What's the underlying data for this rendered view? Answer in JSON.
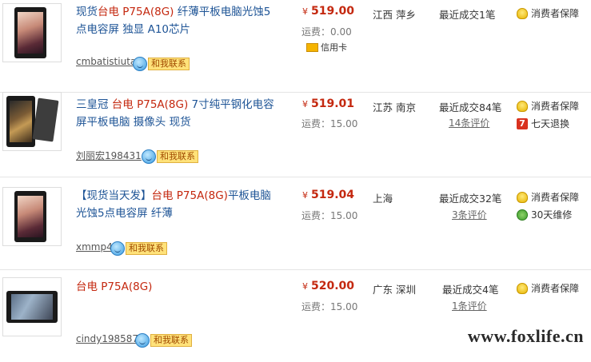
{
  "listings": [
    {
      "title_pre": "现货",
      "title_hl": "台电 P75A(8G)",
      "title_post": " 纤薄平板电脑光蚀5点电容屏 独显 A10芯片",
      "seller": "cmbatistiuta",
      "chat_label": "和我联系",
      "price": "519.00",
      "currency": "¥",
      "shipping": "运费：0.00",
      "payment": "信用卡",
      "location": "江西 萍乡",
      "deals": "最近成交1笔",
      "reviews": "",
      "services": [
        {
          "icon": "consumer-protection-icon",
          "label": "消费者保障"
        }
      ]
    },
    {
      "title_pre": "三皇冠 ",
      "title_hl": "台电 P75A(8G)",
      "title_post": " 7寸纯平钢化电容屏平板电脑 摄像头 现货",
      "seller": "刘丽宏198431",
      "chat_label": "和我联系",
      "price": "519.01",
      "currency": "¥",
      "shipping": "运费：15.00",
      "location": "江苏 南京",
      "deals": "最近成交84笔",
      "reviews": "14条评价",
      "services": [
        {
          "icon": "consumer-protection-icon",
          "label": "消费者保障"
        },
        {
          "icon": "seven-day-return-icon",
          "label": "七天退换"
        }
      ]
    },
    {
      "title_pre": "【现货当天发】",
      "title_hl": "台电 P75A(8G)",
      "title_post": "平板电脑 光蚀5点电容屏 纤薄",
      "seller": "xmmp4",
      "chat_label": "和我联系",
      "price": "519.04",
      "currency": "¥",
      "shipping": "运费：15.00",
      "location": "上海",
      "deals": "最近成交32笔",
      "reviews": "3条评价",
      "services": [
        {
          "icon": "consumer-protection-icon",
          "label": "消费者保障"
        },
        {
          "icon": "thirty-day-repair-icon",
          "label": "30天维修"
        }
      ]
    },
    {
      "title_pre": "",
      "title_hl": "台电 P75A(8G)",
      "title_post": "",
      "seller": "cindy198587",
      "chat_label": "和我联系",
      "price": "520.00",
      "currency": "¥",
      "shipping": "运费：15.00",
      "location": "广东 深圳",
      "deals": "最近成交4笔",
      "reviews": "1条评价",
      "services": [
        {
          "icon": "consumer-protection-icon",
          "label": "消费者保障"
        }
      ]
    }
  ],
  "watermark": "www.foxlife.cn",
  "colors": {
    "title": "#1e5496",
    "highlight": "#c4280f",
    "price": "#c4280f"
  }
}
